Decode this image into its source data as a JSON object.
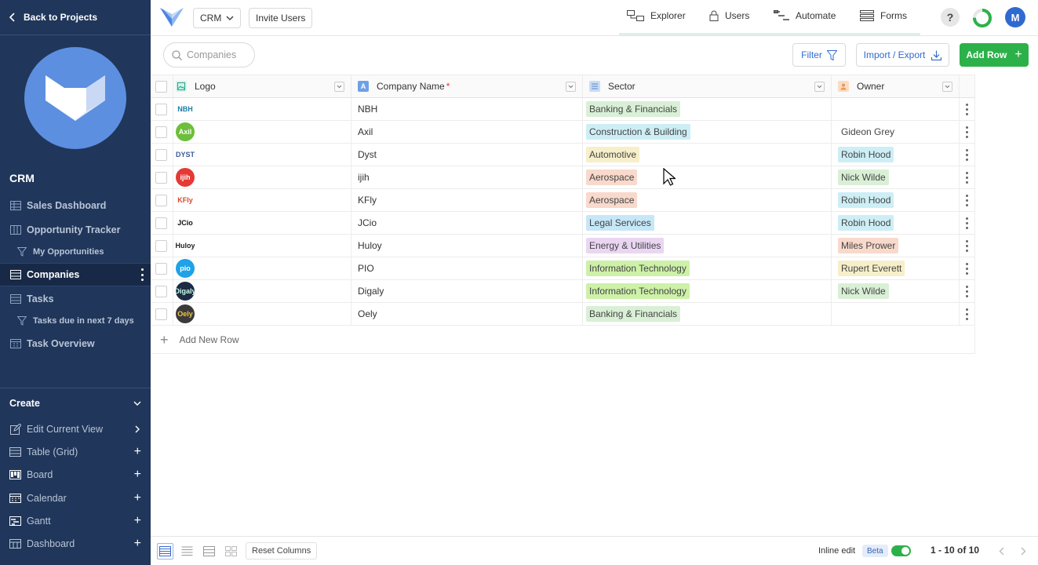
{
  "sidebar": {
    "back_label": "Back to Projects",
    "project_name": "CRM",
    "nav": [
      {
        "label": "Sales Dashboard",
        "icon": "grid-icon"
      },
      {
        "label": "Opportunity Tracker",
        "icon": "board-icon"
      },
      {
        "label": "My Opportunities",
        "icon": "filter-icon"
      },
      {
        "label": "Companies",
        "icon": "grid-icon"
      },
      {
        "label": "Tasks",
        "icon": "grid-icon"
      },
      {
        "label": "Tasks due in next 7 days",
        "icon": "filter-icon"
      },
      {
        "label": "Task Overview",
        "icon": "calendar-icon"
      }
    ],
    "create_label": "Create",
    "views": [
      {
        "label": "Edit Current View",
        "icon": "edit-icon"
      },
      {
        "label": "Table (Grid)",
        "icon": "grid-icon"
      },
      {
        "label": "Board",
        "icon": "board-icon"
      },
      {
        "label": "Calendar",
        "icon": "calendar-icon"
      },
      {
        "label": "Gantt",
        "icon": "gantt-icon"
      },
      {
        "label": "Dashboard",
        "icon": "dashboard-icon"
      }
    ],
    "colors": {
      "bg": "#20365a",
      "active_bg": "#172946",
      "logo": "#5c8fe0"
    }
  },
  "topbar": {
    "project_select": "CRM",
    "invite_label": "Invite Users",
    "nav": [
      {
        "label": "Explorer",
        "icon": "explorer-icon"
      },
      {
        "label": "Users",
        "icon": "lock-icon"
      },
      {
        "label": "Automate",
        "icon": "automate-icon"
      },
      {
        "label": "Forms",
        "icon": "forms-icon"
      }
    ],
    "help": "?",
    "avatar_initial": "M",
    "progress": 0.75
  },
  "toolbar": {
    "search_placeholder": "Companies",
    "filter_label": "Filter",
    "import_label": "Import / Export",
    "add_row_label": "Add Row",
    "accent": "#2cb14a",
    "link_color": "#2f6ad0"
  },
  "table": {
    "columns": [
      {
        "label": "Logo",
        "icon": "image-icon"
      },
      {
        "label": "Company Name",
        "required": "*",
        "icon": "text-icon"
      },
      {
        "label": "Sector",
        "icon": "select-icon"
      },
      {
        "label": "Owner",
        "icon": "user-icon"
      }
    ],
    "rows": [
      {
        "logo": "NBH",
        "name": "NBH",
        "sector": "Banking & Financials",
        "sector_color": "#d9f0d6",
        "owner": "",
        "owner_color": ""
      },
      {
        "logo": "Axil",
        "name": "Axil",
        "sector": "Construction & Building",
        "sector_color": "#cdeef5",
        "owner": "Gideon Grey",
        "owner_color": ""
      },
      {
        "logo": "DYST",
        "name": "Dyst",
        "sector": "Automotive",
        "sector_color": "#f6efc9",
        "owner": "Robin Hood",
        "owner_color": "#cdeef5"
      },
      {
        "logo": "ijih",
        "name": "ijih",
        "sector": "Aerospace",
        "sector_color": "#f8d9cb",
        "owner": "Nick Wilde",
        "owner_color": "#d9f0d6"
      },
      {
        "logo": "KFly",
        "name": "KFly",
        "sector": "Aerospace",
        "sector_color": "#f8d9cb",
        "owner": "Robin Hood",
        "owner_color": "#cdeef5"
      },
      {
        "logo": "JCio",
        "name": "JCio",
        "sector": "Legal Services",
        "sector_color": "#c6e7f7",
        "owner": "Robin Hood",
        "owner_color": "#cdeef5"
      },
      {
        "logo": "Huloy",
        "name": "Huloy",
        "sector": "Energy & Utilities",
        "sector_color": "#ead6f3",
        "owner": "Miles Prower",
        "owner_color": "#f8d9cb"
      },
      {
        "logo": "pio",
        "name": "PIO",
        "sector": "Information Technology",
        "sector_color": "#cdf1a8",
        "owner": "Rupert Everett",
        "owner_color": "#f6efc9"
      },
      {
        "logo": "Digaly",
        "name": "Digaly",
        "sector": "Information Technology",
        "sector_color": "#cdf1a8",
        "owner": "Nick Wilde",
        "owner_color": "#d9f0d6"
      },
      {
        "logo": "Oely",
        "name": "Oely",
        "sector": "Banking & Financials",
        "sector_color": "#d9f0d6",
        "owner": "",
        "owner_color": ""
      }
    ],
    "add_new_label": "Add New Row"
  },
  "footer": {
    "reset_label": "Reset Columns",
    "inline_edit_label": "Inline edit",
    "beta_label": "Beta",
    "inline_edit_on": true,
    "pager_text": "1 - 10 of 10"
  }
}
